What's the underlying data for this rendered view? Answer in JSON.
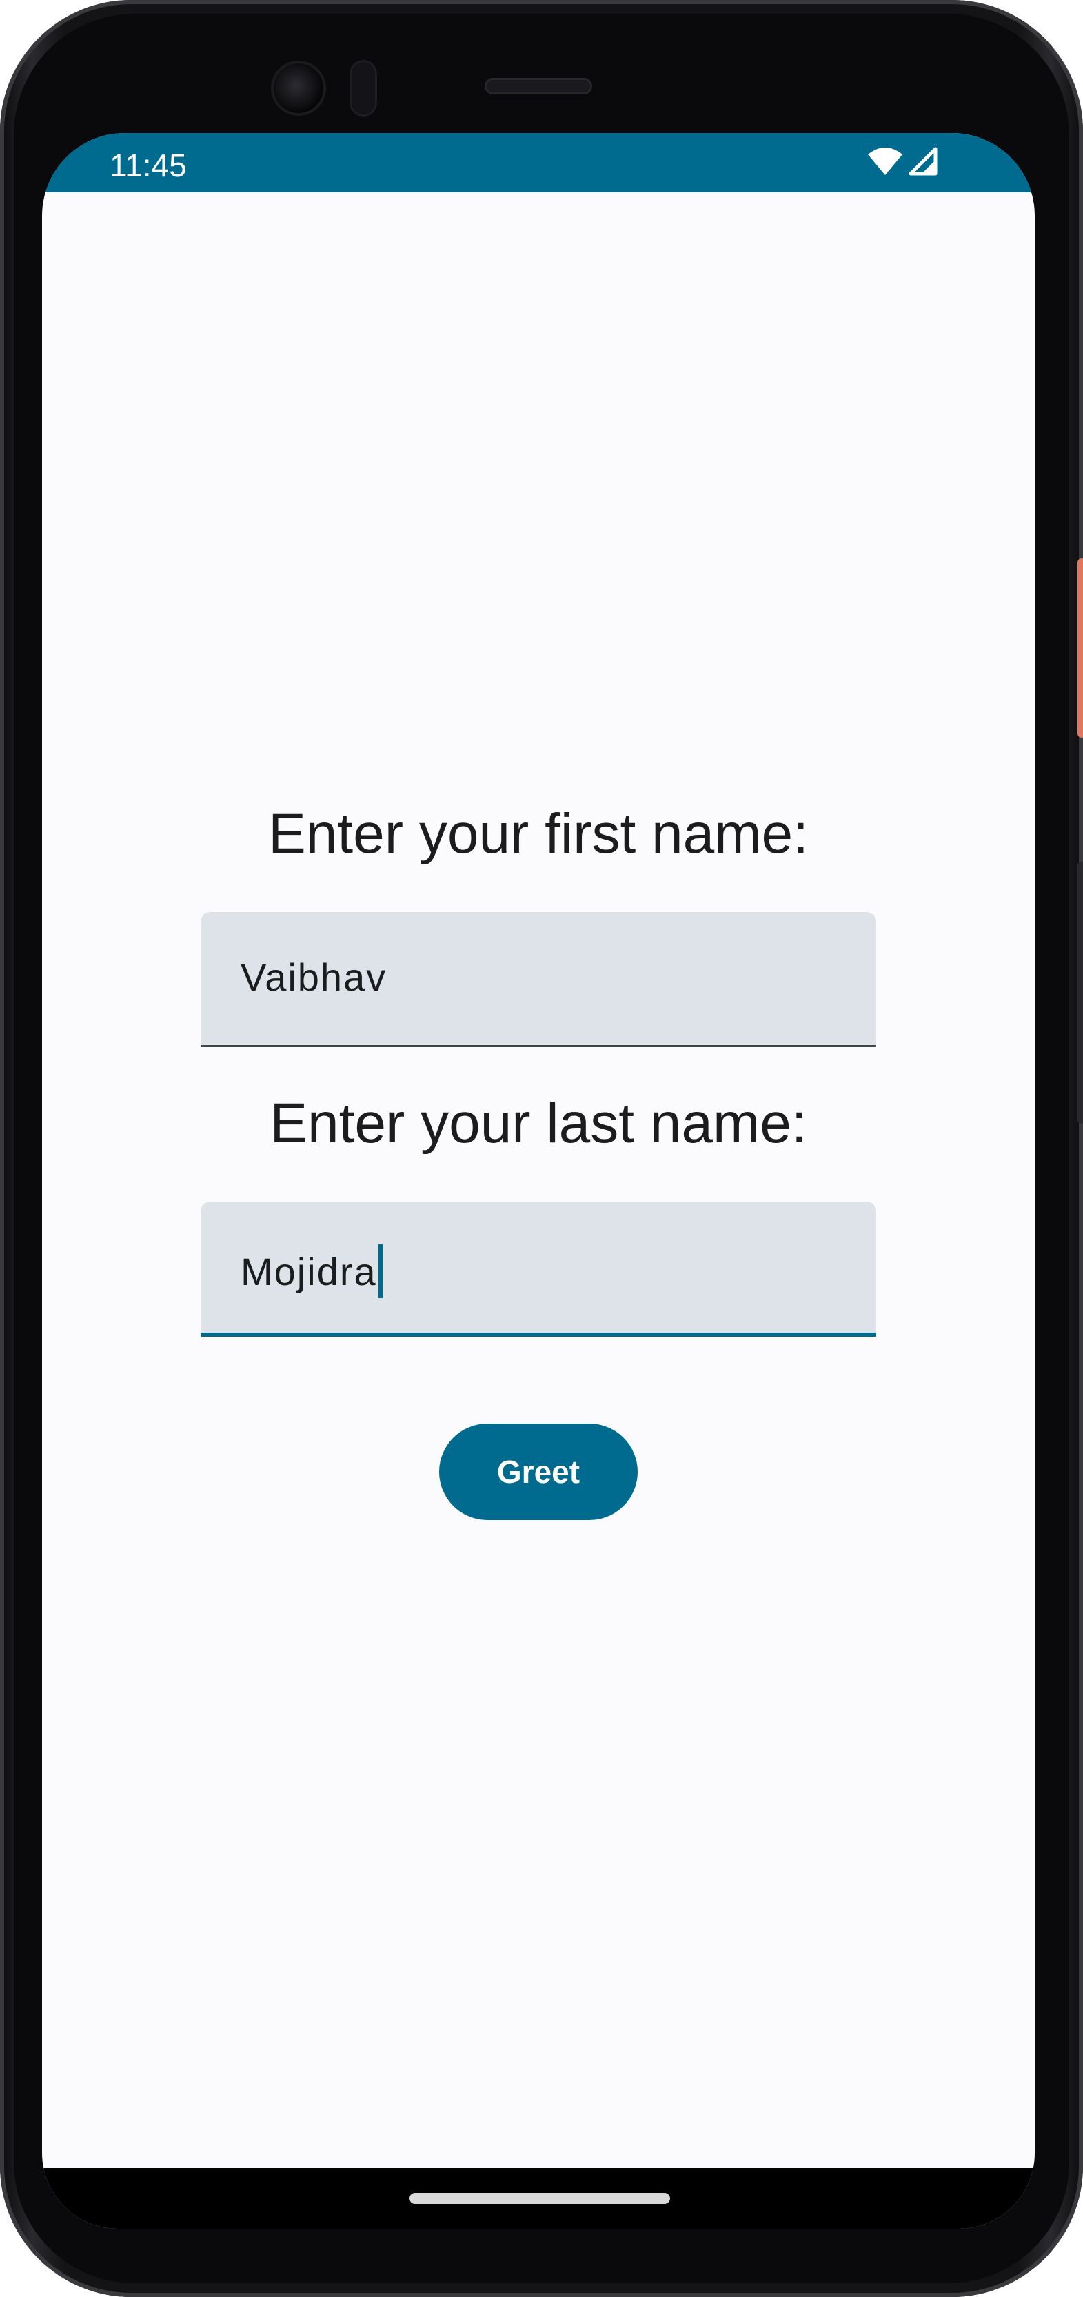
{
  "status_bar": {
    "time": "11:45",
    "icons": [
      "wifi-icon",
      "cellular-signal-icon"
    ],
    "color": "#006b8f"
  },
  "form": {
    "first_name_label": "Enter your first name:",
    "first_name_value": "Vaibhav",
    "last_name_label": "Enter your last name:",
    "last_name_value": "Mojidra",
    "focused_field": "last_name"
  },
  "actions": {
    "greet_label": "Greet"
  },
  "colors": {
    "accent": "#006b8f",
    "field_bg": "#dde3e9",
    "background": "#fbfbfd"
  }
}
